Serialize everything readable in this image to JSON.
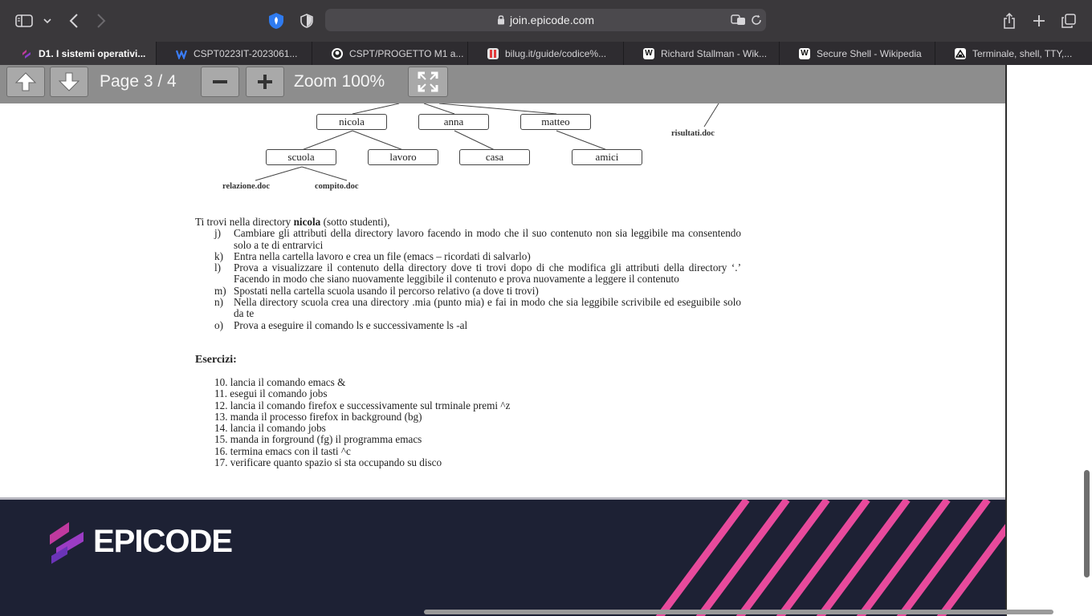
{
  "browser": {
    "url": "join.epicode.com",
    "tabs": [
      {
        "label": "D1. I sistemi operativi...",
        "active": true,
        "icon": "epicode-icon"
      },
      {
        "label": "CSPT0223IT-2023061...",
        "active": false,
        "icon": "wiz-icon"
      },
      {
        "label": "CSPT/PROGETTO M1 a...",
        "active": false,
        "icon": "github-icon"
      },
      {
        "label": "bilug.it/guide/codice%...",
        "active": false,
        "icon": "bilug-icon"
      },
      {
        "label": "Richard Stallman - Wik...",
        "active": false,
        "icon": "wikipedia-icon"
      },
      {
        "label": "Secure Shell - Wikipedia",
        "active": false,
        "icon": "wikipedia-icon"
      },
      {
        "label": "Terminale, shell, TTY,...",
        "active": false,
        "icon": "terminal-site-icon"
      }
    ]
  },
  "viewer": {
    "page_indicator": "Page 3 / 4",
    "zoom_label": "Zoom 100%"
  },
  "document": {
    "tree": {
      "nodes": [
        "nicola",
        "anna",
        "matteo",
        "scuola",
        "lavoro",
        "casa",
        "amici"
      ],
      "files": [
        "risultati.doc",
        "relazione.doc",
        "compito.doc"
      ]
    },
    "intro_start": "Ti trovi nella directory ",
    "intro_bold": "nicola",
    "intro_end": " (sotto studenti),",
    "items": [
      {
        "label": "j)",
        "text": "Cambiare gli attributi della directory lavoro facendo in modo che il suo contenuto non sia leggibile ma consentendo solo a te di entrarvici"
      },
      {
        "label": "k)",
        "text": "Entra nella cartella lavoro e crea un file (emacs – ricordati di salvarlo)"
      },
      {
        "label": "l)",
        "text": "Prova a visualizzare il contenuto della directory dove ti trovi dopo di che modifica gli attributi della directory ‘.’ Facendo in modo che siano nuovamente leggibile il contenuto e prova nuovamente a leggere il contenuto"
      },
      {
        "label": "m)",
        "text": "Spostati nella cartella scuola usando il percorso relativo (a dove ti trovi)"
      },
      {
        "label": "n)",
        "text": "Nella directory scuola crea una directory .mia (punto mia) e fai in modo che sia leggibile scrivibile ed eseguibile solo da te"
      },
      {
        "label": "o)",
        "text": "Prova a eseguire il comando ls e successivamente ls -al"
      }
    ],
    "exercises_title": "Esercizi:",
    "exercises": [
      "10. lancia il comando emacs &",
      "11. esegui il comando jobs",
      "12. lancia il comando firefox e successivamente sul trminale premi ^z",
      "13. manda il processo firefox in background (bg)",
      "14. lancia il comando jobs",
      "15. manda in forground (fg) il programma emacs",
      "16. termina emacs con il tasti ^c",
      "17. verificare quanto spazio si sta occupando su disco"
    ]
  },
  "promo": {
    "logo_text": "EPICODE"
  },
  "colors": {
    "toolbar": "#3a383b",
    "pdfbar": "#8d8d8d",
    "promo_bg": "#1d2134",
    "accent_pink": "#ff3d9a"
  }
}
